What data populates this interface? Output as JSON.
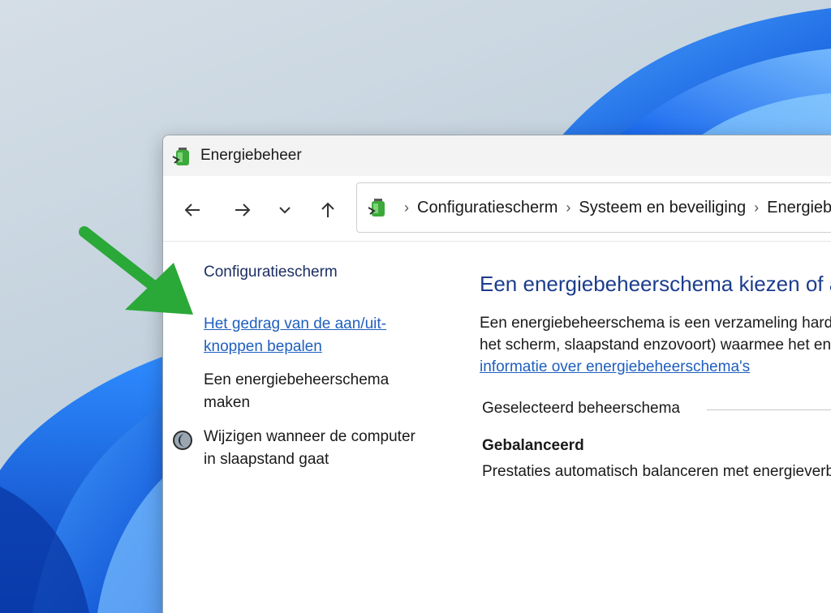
{
  "window": {
    "title": "Energiebeheer"
  },
  "nav": {
    "back_icon": "arrow-left-icon",
    "forward_icon": "arrow-right-icon",
    "recent_icon": "chevron-down-icon",
    "up_icon": "arrow-up-icon"
  },
  "breadcrumb": {
    "items": [
      "Configuratiescherm",
      "Systeem en beveiliging",
      "Energiebeheer"
    ]
  },
  "left_pane": {
    "home_link": "Configuratiescherm",
    "links": [
      "Het gedrag van de aan/uit-knoppen bepalen",
      "Een energiebeheerschema maken",
      "Wijzigen wanneer de computer in slaapstand gaat"
    ]
  },
  "main": {
    "heading": "Een energiebeheerschema kiezen of aanpassen",
    "desc_line1": "Een energiebeheerschema is een verzameling hardware- en systeeminstellingen (zoals",
    "desc_line2": "het scherm, slaapstand enzovoort) waarmee het energieverbruik wordt beheerd.",
    "info_link": "informatie over energiebeheerschema's",
    "selected_label": "Geselecteerd beheerschema",
    "plan_name": "Gebalanceerd",
    "plan_desc": "Prestaties automatisch balanceren met energieverbruik op geschikte hardware."
  },
  "colors": {
    "heading": "#1c3d8c",
    "link": "#1f5fbf",
    "annotation_arrow": "#2aa838"
  }
}
